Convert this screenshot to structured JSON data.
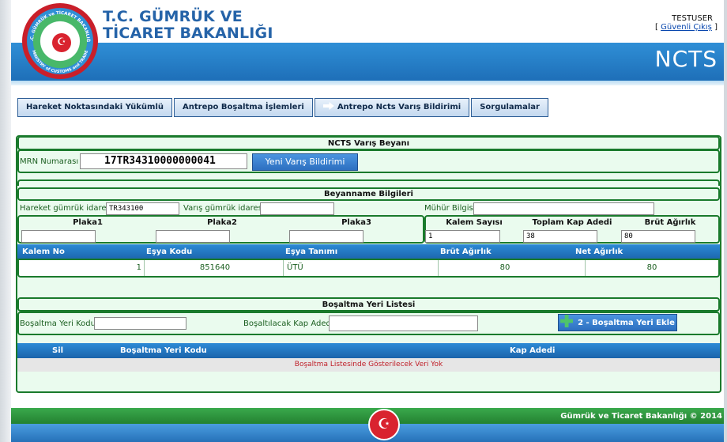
{
  "header": {
    "org_line1": "T.C. GÜMRÜK VE",
    "org_line2": "TİCARET BAKANLIĞI",
    "user": "TESTUSER",
    "logout_label": "Güvenli Çıkış",
    "app_name": "NCTS",
    "logo_ring_top": "T.C. GÜMRÜK ve TİCARET BAKANLIĞI",
    "logo_ring_bottom": "MINISTRY of CUSTOMS and TRADE"
  },
  "menu": [
    {
      "label": "Hareket Noktasındaki Yükümlü"
    },
    {
      "label": "Antrepo Boşaltma İşlemleri"
    },
    {
      "label": "Antrepo Ncts Varış Bildirimi"
    },
    {
      "label": "Sorgulamalar"
    }
  ],
  "varis": {
    "title": "NCTS Varış Beyanı",
    "mrn_label": "MRN Numarası",
    "mrn_value": "17TR34310000000041",
    "new_button": "Yeni Varış Bildirimi"
  },
  "beyanname": {
    "title": "Beyanname Bilgileri",
    "hareket_label": "Hareket gümrük idaresi",
    "hareket_value": "TR343100",
    "varis_label": "Varış gümrük idaresi",
    "varis_value": "",
    "muhur_label": "Mühür Bilgisi",
    "muhur_value": "",
    "plaka1": "Plaka1",
    "plaka2": "Plaka2",
    "plaka3": "Plaka3",
    "kalem_sayisi_label": "Kalem Sayısı",
    "kalem_sayisi_value": "1",
    "toplam_kap_label": "Toplam Kap Adedi",
    "toplam_kap_value": "38",
    "brut_label": "Brüt Ağırlık",
    "brut_value": "80"
  },
  "items_table": {
    "headers": [
      "Kalem No",
      "Eşya Kodu",
      "Eşya Tanımı",
      "Brüt Ağırlık",
      "Net Ağırlık"
    ],
    "rows": [
      {
        "kalem_no": "1",
        "esya_kodu": "851640",
        "esya_tanimi": "ÜTÜ",
        "brut": "80",
        "net": "80"
      }
    ]
  },
  "bosaltma": {
    "title": "Boşaltma Yeri Listesi",
    "kod_label": "Boşaltma Yeri Kodu",
    "kod_value": "",
    "kap_label": "Boşaltılacak Kap Adedi",
    "kap_value": "",
    "add_button": "2 - Boşaltma Yeri Ekle",
    "headers": [
      "Sil",
      "Boşaltma Yeri Kodu",
      "Kap Adedi"
    ],
    "empty_message": "Boşaltma Listesinde Gösterilecek Veri Yok"
  },
  "footer": {
    "copyright": "Gümrük ve Ticaret Bakanlığı © 2014"
  },
  "colors": {
    "accent_blue": "#2563a8",
    "panel_green": "#1a7a2c",
    "panel_bg": "#eafbee",
    "error_red": "#c0202a"
  }
}
